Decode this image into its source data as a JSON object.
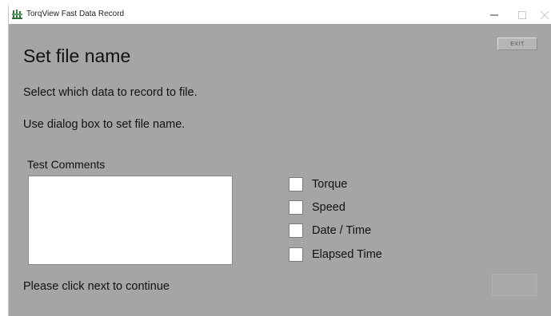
{
  "window": {
    "title": "TorqView Fast Data Record",
    "app_icon": "torqview-app-icon",
    "controls": {
      "minimize_icon": "minimize-icon",
      "maximize_icon": "maximize-icon",
      "close_icon": "close-icon"
    }
  },
  "header": {
    "exit_label": "EXIT"
  },
  "main": {
    "title": "Set file name",
    "instructions": [
      "Select which data to record to file.",
      "Use dialog box to set file name."
    ],
    "comments": {
      "label": "Test Comments",
      "value": ""
    },
    "checkboxes": [
      {
        "label": "Torque",
        "checked": false
      },
      {
        "label": "Speed",
        "checked": false
      },
      {
        "label": "Date / Time",
        "checked": false
      },
      {
        "label": "Elapsed Time",
        "checked": false
      }
    ],
    "footer_text": "Please click next to continue"
  },
  "colors": {
    "window_background": "#a5a5a5",
    "titlebar_background": "#ffffff"
  }
}
